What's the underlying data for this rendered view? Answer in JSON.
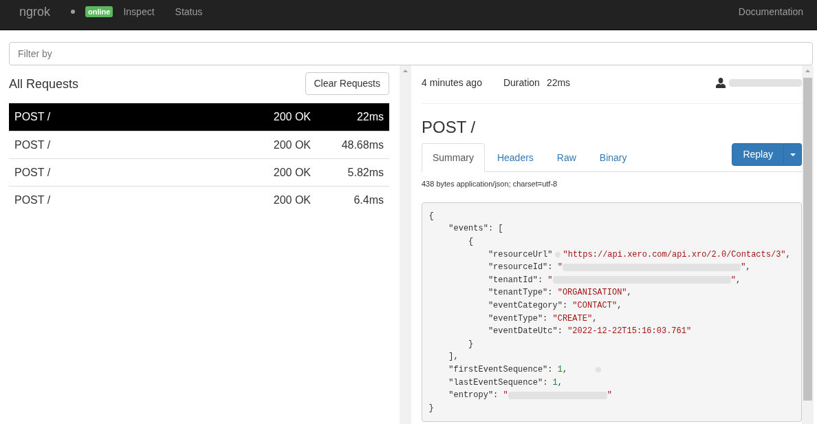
{
  "navbar": {
    "brand": "ngrok",
    "status_badge": "online",
    "links": [
      {
        "label": "Inspect"
      },
      {
        "label": "Status"
      }
    ],
    "documentation_link": "Documentation"
  },
  "filter": {
    "placeholder": "Filter by"
  },
  "requests": {
    "title": "All Requests",
    "clear_button": "Clear Requests",
    "rows": [
      {
        "request": "POST /",
        "status": "200 OK",
        "duration": "22ms",
        "selected": true
      },
      {
        "request": "POST /",
        "status": "200 OK",
        "duration": "48.68ms",
        "selected": false
      },
      {
        "request": "POST /",
        "status": "200 OK",
        "duration": "5.82ms",
        "selected": false
      },
      {
        "request": "POST /",
        "status": "200 OK",
        "duration": "6.4ms",
        "selected": false
      }
    ]
  },
  "detail": {
    "time_ago": "4 minutes ago",
    "duration_label": "Duration",
    "duration": "22ms",
    "title": "POST /",
    "tabs": [
      {
        "label": "Summary",
        "selected": true
      },
      {
        "label": "Headers",
        "selected": false
      },
      {
        "label": "Raw",
        "selected": false
      },
      {
        "label": "Binary",
        "selected": false
      }
    ],
    "replay_button": "Replay",
    "content_info": "438 bytes application/json; charset=utf-8",
    "body": [
      {
        "tokens": [
          {
            "kind": "punct",
            "text": "{"
          }
        ],
        "children": [
          {
            "tokens": [
              {
                "kind": "key",
                "text": "\"events\""
              },
              {
                "kind": "punct",
                "text": ": ["
              }
            ],
            "children": [
              {
                "tokens": [
                  {
                    "kind": "punct",
                    "text": "{"
                  }
                ],
                "children": [
                  {
                    "tokens": [
                      {
                        "kind": "key",
                        "text": "\"resourceUrl\""
                      },
                      {
                        "kind": "blot"
                      },
                      {
                        "kind": "string",
                        "text": "\"https://api.xero.com/api.xro/2.0/Contacts/3\""
                      },
                      {
                        "kind": "punct",
                        "text": ","
                      }
                    ]
                  },
                  {
                    "tokens": [
                      {
                        "kind": "key",
                        "text": "\"resourceId\""
                      },
                      {
                        "kind": "punct",
                        "text": ": "
                      },
                      {
                        "kind": "string",
                        "text": "\""
                      },
                      {
                        "kind": "redacted_guid"
                      },
                      {
                        "kind": "string",
                        "text": "\""
                      },
                      {
                        "kind": "punct",
                        "text": ","
                      }
                    ]
                  },
                  {
                    "tokens": [
                      {
                        "kind": "key",
                        "text": "\"tenantId\""
                      },
                      {
                        "kind": "punct",
                        "text": ": "
                      },
                      {
                        "kind": "string",
                        "text": "\""
                      },
                      {
                        "kind": "redacted_guid"
                      },
                      {
                        "kind": "string",
                        "text": "\""
                      },
                      {
                        "kind": "punct",
                        "text": ","
                      }
                    ]
                  },
                  {
                    "tokens": [
                      {
                        "kind": "key",
                        "text": "\"tenantType\""
                      },
                      {
                        "kind": "punct",
                        "text": ": "
                      },
                      {
                        "kind": "string",
                        "text": "\"ORGANISATION\""
                      },
                      {
                        "kind": "punct",
                        "text": ","
                      }
                    ]
                  },
                  {
                    "tokens": [
                      {
                        "kind": "key",
                        "text": "\"eventCategory\""
                      },
                      {
                        "kind": "punct",
                        "text": ": "
                      },
                      {
                        "kind": "string",
                        "text": "\"CONTACT\""
                      },
                      {
                        "kind": "punct",
                        "text": ","
                      }
                    ]
                  },
                  {
                    "tokens": [
                      {
                        "kind": "key",
                        "text": "\"eventType\""
                      },
                      {
                        "kind": "punct",
                        "text": ": "
                      },
                      {
                        "kind": "string",
                        "text": "\"CREATE\""
                      },
                      {
                        "kind": "punct",
                        "text": ","
                      }
                    ]
                  },
                  {
                    "tokens": [
                      {
                        "kind": "key",
                        "text": "\"eventDateUtc\""
                      },
                      {
                        "kind": "punct",
                        "text": ": "
                      },
                      {
                        "kind": "string",
                        "text": "\"2022-12-22T15:16:03.761\""
                      }
                    ]
                  }
                ]
              },
              {
                "tokens": [
                  {
                    "kind": "punct",
                    "text": "}"
                  }
                ]
              }
            ]
          },
          {
            "tokens": [
              {
                "kind": "punct",
                "text": "],"
              }
            ]
          },
          {
            "tokens": [
              {
                "kind": "key",
                "text": "\"firstEventSequence\""
              },
              {
                "kind": "punct",
                "text": ": "
              },
              {
                "kind": "number",
                "text": "1"
              },
              {
                "kind": "punct",
                "text": ","
              },
              {
                "kind": "smudge"
              }
            ]
          },
          {
            "tokens": [
              {
                "kind": "key",
                "text": "\"lastEventSequence\""
              },
              {
                "kind": "punct",
                "text": ": "
              },
              {
                "kind": "number",
                "text": "1"
              },
              {
                "kind": "punct",
                "text": ","
              }
            ]
          },
          {
            "tokens": [
              {
                "kind": "key",
                "text": "\"entropy\""
              },
              {
                "kind": "punct",
                "text": ": "
              },
              {
                "kind": "string",
                "text": "\""
              },
              {
                "kind": "redacted_text"
              },
              {
                "kind": "string",
                "text": "\""
              }
            ]
          }
        ]
      },
      {
        "tokens": [
          {
            "kind": "punct",
            "text": "}"
          }
        ]
      }
    ]
  }
}
